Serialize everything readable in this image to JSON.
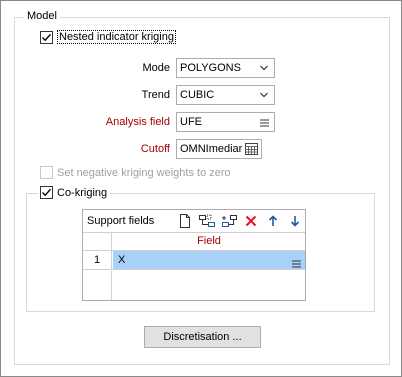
{
  "model": {
    "group_title": "Model",
    "nested_indicator": {
      "label": "Nested indicator kriging",
      "checked": true
    },
    "mode": {
      "label": "Mode",
      "value": "POLYGONS"
    },
    "trend": {
      "label": "Trend",
      "value": "CUBIC"
    },
    "analysis_field": {
      "label": "Analysis field",
      "value": "UFE"
    },
    "cutoff": {
      "label": "Cutoff",
      "value": "OMNImediar"
    },
    "negative_weights": {
      "label": "Set negative kriging weights to zero",
      "checked": false,
      "enabled": false
    },
    "co_kriging": {
      "label": "Co-kriging",
      "checked": true
    },
    "support_fields": {
      "title": "Support fields",
      "column_header": "Field",
      "rows": [
        {
          "num": "1",
          "value": "X"
        }
      ]
    },
    "discretisation_button": "Discretisation ..."
  },
  "icons": [
    "new-row-icon",
    "insert-row-icon",
    "append-row-icon",
    "delete-icon",
    "move-up-icon",
    "move-down-icon",
    "list-menu-icon",
    "calendar-table-icon",
    "chevron-down-icon",
    "check-icon"
  ],
  "colors": {
    "required_label": "#a40000",
    "selection": "#a9d1f7",
    "delete": "#e81123",
    "arrows": "#1e5aa8"
  }
}
